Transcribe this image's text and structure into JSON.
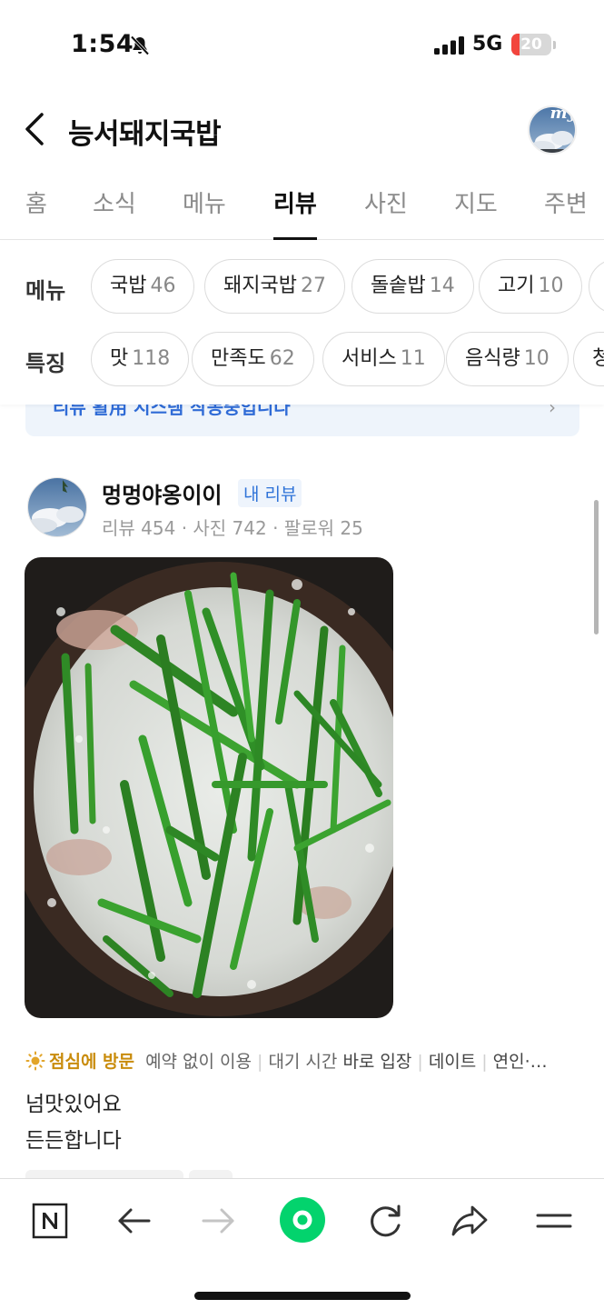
{
  "status_bar": {
    "time": "1:54",
    "network": "5G",
    "battery_level": "20",
    "battery_fraction": 0.2,
    "battery_color": "#f2453d",
    "icons": [
      "bell-slash-icon",
      "signal-icon"
    ]
  },
  "header": {
    "title": "능서돼지국밥",
    "avatar_caption": "my"
  },
  "tabs": [
    {
      "label": "홈",
      "active": false
    },
    {
      "label": "소식",
      "active": false
    },
    {
      "label": "메뉴",
      "active": false
    },
    {
      "label": "리뷰",
      "active": true
    },
    {
      "label": "사진",
      "active": false
    },
    {
      "label": "지도",
      "active": false
    },
    {
      "label": "주변",
      "active": false
    }
  ],
  "filters": {
    "menu": {
      "label": "메뉴",
      "chips": [
        {
          "name": "국밥",
          "count": "46"
        },
        {
          "name": "돼지국밥",
          "count": "27"
        },
        {
          "name": "돌솥밥",
          "count": "14"
        },
        {
          "name": "고기",
          "count": "10"
        }
      ]
    },
    "feature": {
      "label": "특징",
      "chips": [
        {
          "name": "맛",
          "count": "118"
        },
        {
          "name": "만족도",
          "count": "62"
        },
        {
          "name": "서비스",
          "count": "11"
        },
        {
          "name": "음식량",
          "count": "10"
        },
        {
          "name": "청",
          "count": ""
        }
      ]
    }
  },
  "banner": {
    "text": "리뷰 활用 시스템 작동중입니다",
    "accent": "#2f6bd6"
  },
  "review": {
    "author": "멍멍야옹이이",
    "badge": "내 리뷰",
    "stats": "리뷰 454 · 사진 742 · 팔로워 25",
    "visit": {
      "time_of_visit": "점심에 방문",
      "items": [
        {
          "text": "예약 없이 이용",
          "emph": ""
        },
        {
          "text": "대기 시간 ",
          "emph": "바로 입장"
        },
        {
          "text": "데이트",
          "emph": ""
        },
        {
          "text": "연인·…",
          "emph": ""
        }
      ]
    },
    "text_lines": [
      "넘맛있어요",
      "든든합니다"
    ]
  },
  "toolbar": {
    "icons": [
      "naver-n-icon",
      "back-arrow-icon",
      "forward-arrow-icon",
      "green-dot-icon",
      "refresh-icon",
      "share-icon",
      "menu-icon"
    ],
    "accent": "#03d36d"
  }
}
